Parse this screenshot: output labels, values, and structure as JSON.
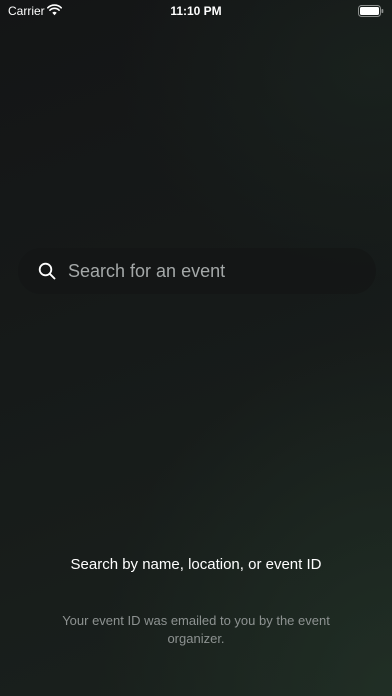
{
  "status_bar": {
    "carrier": "Carrier",
    "time": "11:10 PM"
  },
  "search": {
    "placeholder": "Search for an event",
    "value": "",
    "icon": "search-icon"
  },
  "hint": {
    "title": "Search by name, location, or event ID",
    "subtitle": "Your event ID was emailed to you by the event organizer."
  },
  "colors": {
    "text_primary": "#ffffff",
    "text_placeholder": "#a4a8a8",
    "text_secondary": "#8d9291",
    "background_dark": "#141516",
    "background_accent": "#1a211d"
  }
}
